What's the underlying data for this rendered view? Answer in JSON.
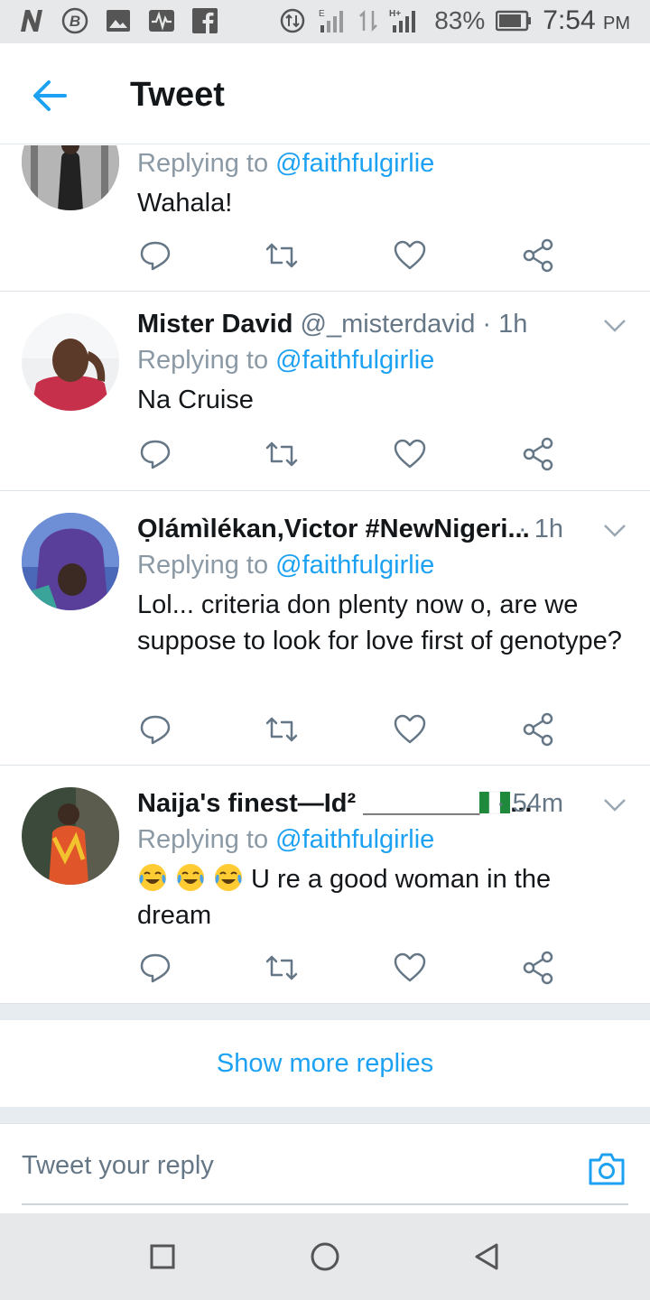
{
  "status_bar": {
    "battery": "83%",
    "time": "7:54",
    "ampm": "PM",
    "network_label": "H+",
    "sim1_label": "E"
  },
  "header": {
    "title": "Tweet"
  },
  "replies": [
    {
      "display_name": "",
      "handle": "",
      "time": "",
      "replying_prefix": "Replying to",
      "replying_to": "@faithfulgirlie",
      "text": "Wahala!"
    },
    {
      "display_name": "Mister David",
      "handle": "@_misterdavid",
      "time": "· 1h",
      "replying_prefix": "Replying to",
      "replying_to": "@faithfulgirlie",
      "text": "Na Cruise"
    },
    {
      "display_name": "Ọlámìlékan,Victor #NewNigeri...",
      "handle": "",
      "time": "· 1h",
      "replying_prefix": "Replying to",
      "replying_to": "@faithfulgirlie",
      "text": "Lol... criteria don plenty now o, are we suppose to look for love first of genotype?"
    },
    {
      "display_name": "Naija's finest—Id² ________",
      "display_name_suffix": "...",
      "handle": "",
      "time": "· 54m",
      "replying_prefix": "Replying to",
      "replying_to": "@faithfulgirlie",
      "text": "U re a good woman in the dream"
    }
  ],
  "show_more": "Show more replies",
  "reply_bar": {
    "placeholder": "Tweet your reply"
  },
  "colors": {
    "accent": "#1da1f2",
    "text": "#14171a",
    "muted": "#657786",
    "divider": "#e6ecf0"
  }
}
